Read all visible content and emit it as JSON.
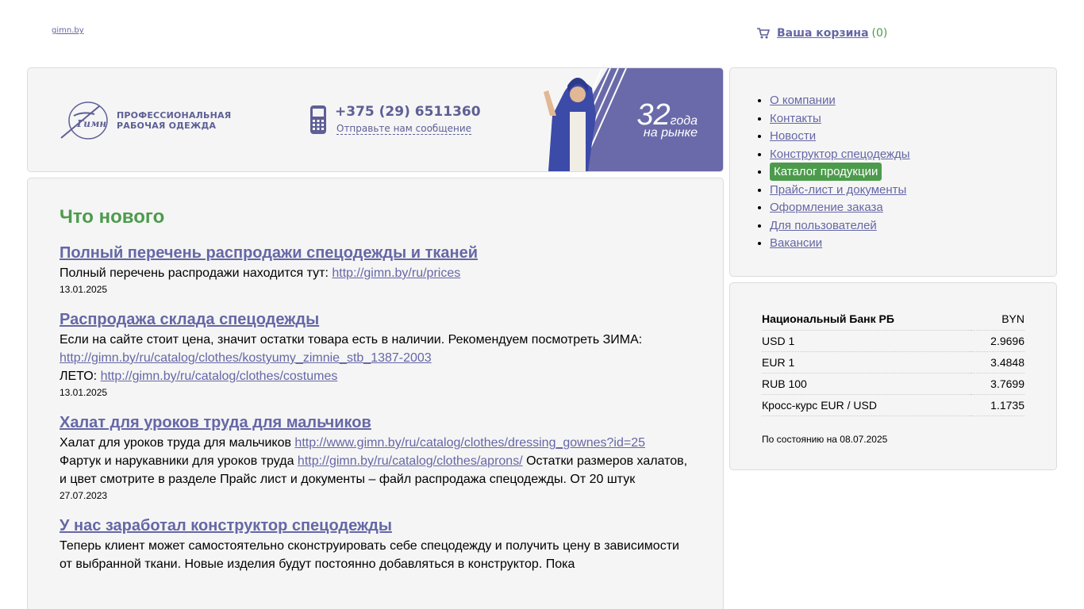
{
  "top": {
    "site_link": "gimn.by"
  },
  "cart": {
    "label": "Ваша корзина",
    "count": "(0)"
  },
  "header": {
    "logo_line1": "ПРОФЕССИОНАЛЬНАЯ",
    "logo_line2": "РАБОЧАЯ  ОДЕЖДА",
    "phone": "+375 (29) 6511360",
    "message_link": "Отправьте нам сообщение",
    "banner_years": "32",
    "banner_years_word": "года",
    "banner_market": "на рынке"
  },
  "news": {
    "title": "Что нового",
    "items": [
      {
        "title": "Полный перечень распродажи спецодежды и тканей",
        "text_prefix": "Полный перечень распродажи находится тут: ",
        "link1": "http://gimn.by/ru/prices",
        "date": "13.01.2025"
      },
      {
        "title": "Распродажа склада спецодежды",
        "text_prefix": "Если на сайте стоит цена, значит остатки товара есть в наличии. Рекомендуем посмотреть ЗИМА: ",
        "link1": "http://gimn.by/ru/catalog/clothes/kostyumy_zimnie_stb_1387-2003",
        "text_mid": "ЛЕТО: ",
        "link2": "http://gimn.by/ru/catalog/clothes/costumes",
        "date": "13.01.2025"
      },
      {
        "title": "Халат для уроков труда для мальчиков",
        "text_prefix": "Халат для уроков труда для мальчиков ",
        "link1": "http://www.gimn.by/ru/catalog/clothes/dressing_gownes?id=25",
        "text_mid": "Фартук и нарукавники для уроков труда ",
        "link2": "http://gimn.by/ru/catalog/clothes/aprons/",
        "text_suffix": " Остатки размеров халатов, и цвет смотрите в разделе Прайс лист и документы – файл распродажа спецодежды. От 20 штук",
        "date": "27.07.2023"
      },
      {
        "title": "У нас заработал конструктор спецодежды",
        "text_prefix": "Теперь клиент может самостоятельно сконструировать себе спецодежду и получить цену в зависимости от выбранной ткани. Новые изделия будут постоянно добавляться в конструктор. Пока",
        "date": ""
      }
    ]
  },
  "menu": {
    "items": [
      {
        "label": "О компании"
      },
      {
        "label": "Контакты"
      },
      {
        "label": "Новости"
      },
      {
        "label": "Конструктор спецодежды"
      },
      {
        "label": "Каталог продукции"
      },
      {
        "label": "Прайс-лист и документы"
      },
      {
        "label": "Оформление заказа"
      },
      {
        "label": "Для пользователей"
      },
      {
        "label": "Вакансии"
      }
    ],
    "active_label": "Каталог продукции"
  },
  "rates": {
    "header_name": "Национальный Банк РБ",
    "header_currency": "BYN",
    "rows": [
      {
        "name": "USD 1",
        "value": "2.9696"
      },
      {
        "name": "EUR 1",
        "value": "3.4848"
      },
      {
        "name": "RUB 100",
        "value": "3.7699"
      },
      {
        "name": "Кросс-курс EUR / USD",
        "value": "1.1735"
      }
    ],
    "date": "По состоянию на 08.07.2025"
  },
  "colors": {
    "accent_green": "#4c9b4c",
    "link_purple": "#6567a6",
    "banner_bg": "#6a6aaa"
  }
}
